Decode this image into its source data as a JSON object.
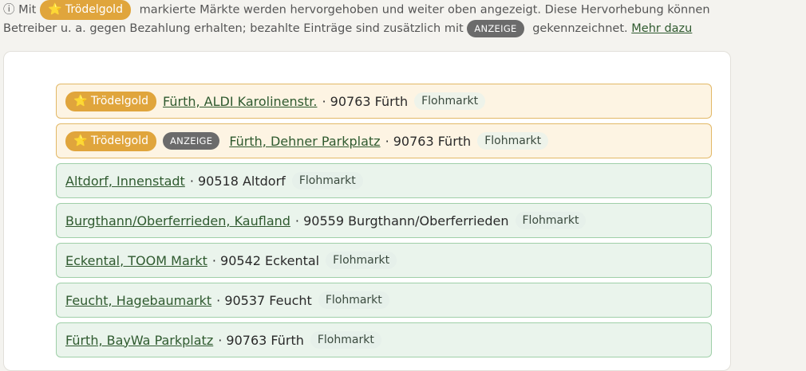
{
  "notice": {
    "info_icon": "ⓘ",
    "prefix": "Mit",
    "gold_badge": "⭐ Trödelgold",
    "text1": "markierte Märkte werden hervorgehoben und weiter oben angezeigt. Diese Hervorhebung können",
    "text2": "Betreiber u. a. gegen Bezahlung erhalten; bezahlte Einträge sind zusätzlich mit",
    "ad_badge": "ANZEIGE",
    "text3": "gekennzeichnet.",
    "more_link": "Mehr dazu"
  },
  "markets": [
    {
      "name": "Fürth, ALDI Karolinenstr.",
      "address": "· 90763 Fürth",
      "type": "Flohmarkt",
      "gold": true,
      "ad": false,
      "gold_label": "⭐ Trödelgold"
    },
    {
      "name": "Fürth, Dehner Parkplatz",
      "address": "· 90763 Fürth",
      "type": "Flohmarkt",
      "gold": true,
      "ad": true,
      "gold_label": "⭐ Trödelgold",
      "ad_label": "ANZEIGE"
    },
    {
      "name": "Altdorf, Innenstadt",
      "address": "· 90518 Altdorf",
      "type": "Flohmarkt"
    },
    {
      "name": "Burgthann/Oberferrieden, Kaufland",
      "address": "· 90559 Burgthann/Oberferrieden",
      "type": "Flohmarkt"
    },
    {
      "name": "Eckental, TOOM Markt",
      "address": "· 90542 Eckental",
      "type": "Flohmarkt"
    },
    {
      "name": "Feucht, Hagebaumarkt",
      "address": "· 90537 Feucht",
      "type": "Flohmarkt"
    },
    {
      "name": "Fürth, BayWa Parkplatz",
      "address": "· 90763 Fürth",
      "type": "Flohmarkt"
    }
  ],
  "colors": {
    "gold": "#e0a53c",
    "ad": "#6b6b6b",
    "link": "#2f5a2f"
  }
}
